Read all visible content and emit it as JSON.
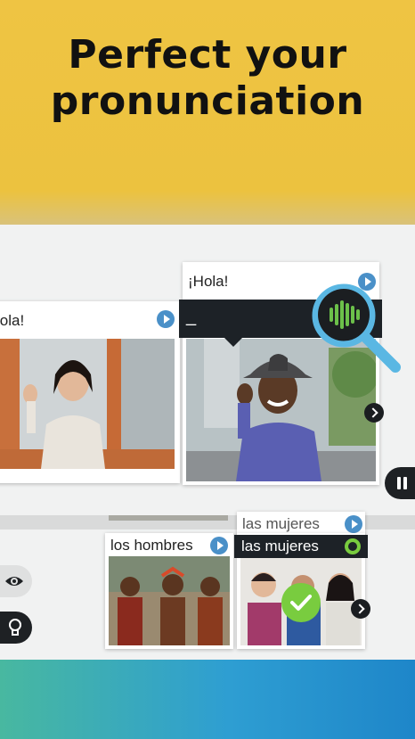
{
  "hero": {
    "line1": "Perfect your",
    "line2": "pronunciation"
  },
  "lesson": {
    "left_card": {
      "caption": "lola!"
    },
    "right_card": {
      "caption": "¡Hola!",
      "typed": "_"
    },
    "word_cards": [
      {
        "caption": "los hombres"
      },
      {
        "caption": "las mujeres",
        "answer": "las mujeres"
      }
    ]
  },
  "colors": {
    "brand_yellow": "#efc443",
    "accent_blue": "#4a90c8",
    "success_green": "#79cc3f",
    "mic_green": "#6cc04a"
  },
  "icons": [
    "play-icon",
    "microphone-wave-icon",
    "magnifier-icon",
    "chevron-right-icon",
    "pause-icon",
    "eye-icon",
    "lightbulb-icon",
    "checkmark-icon",
    "ring-icon"
  ]
}
